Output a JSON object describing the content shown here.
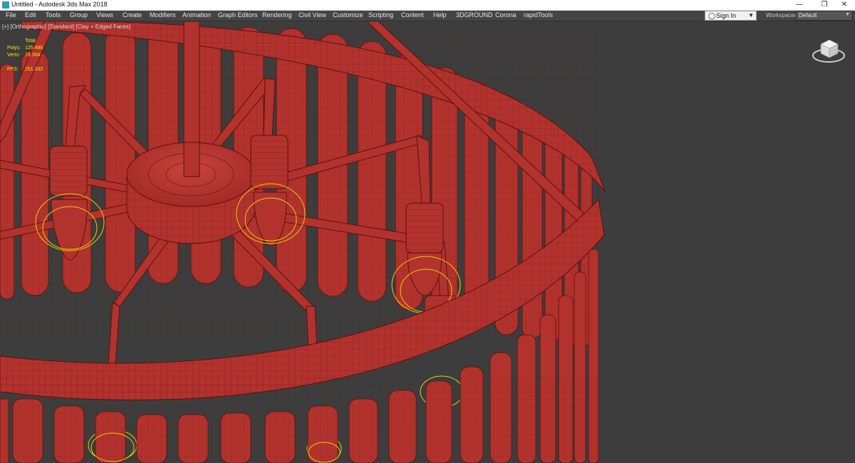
{
  "window": {
    "title": "Untitled - Autodesk 3ds Max 2018"
  },
  "window_controls": {
    "minimize": "—",
    "restore": "❐",
    "close": "✕"
  },
  "menu": {
    "items": [
      "File",
      "Edit",
      "Tools",
      "Group",
      "Views",
      "Create",
      "Modifiers",
      "Animation",
      "Graph Editors",
      "Rendering",
      "Civil View",
      "Customize",
      "Scripting",
      "Content",
      "Help",
      "3DGROUND",
      "Corona",
      "rapidTools"
    ]
  },
  "signin": {
    "label": "Sign In",
    "icon": "user-icon"
  },
  "workspaces": {
    "label": "Workspaces:",
    "value": "Default"
  },
  "viewport": {
    "label": "[+] [Orthographic] [Standard] [Clay + Edged Faces]",
    "stats": {
      "header": "Total",
      "polys_label": "Polys:",
      "polys": "125 486",
      "verts_label": "Verts:",
      "verts": "73 304",
      "fps_label": "FPS:",
      "fps": "251.332"
    }
  },
  "colors": {
    "titlebar_bg": "#ffffff",
    "menubar_bg": "#444444",
    "viewport_bg": "#3d3d3d",
    "model_fill": "#b2322d",
    "model_edge": "#5a1210",
    "stats_text": "#ffe400",
    "light_gizmo": "#e8d000"
  }
}
